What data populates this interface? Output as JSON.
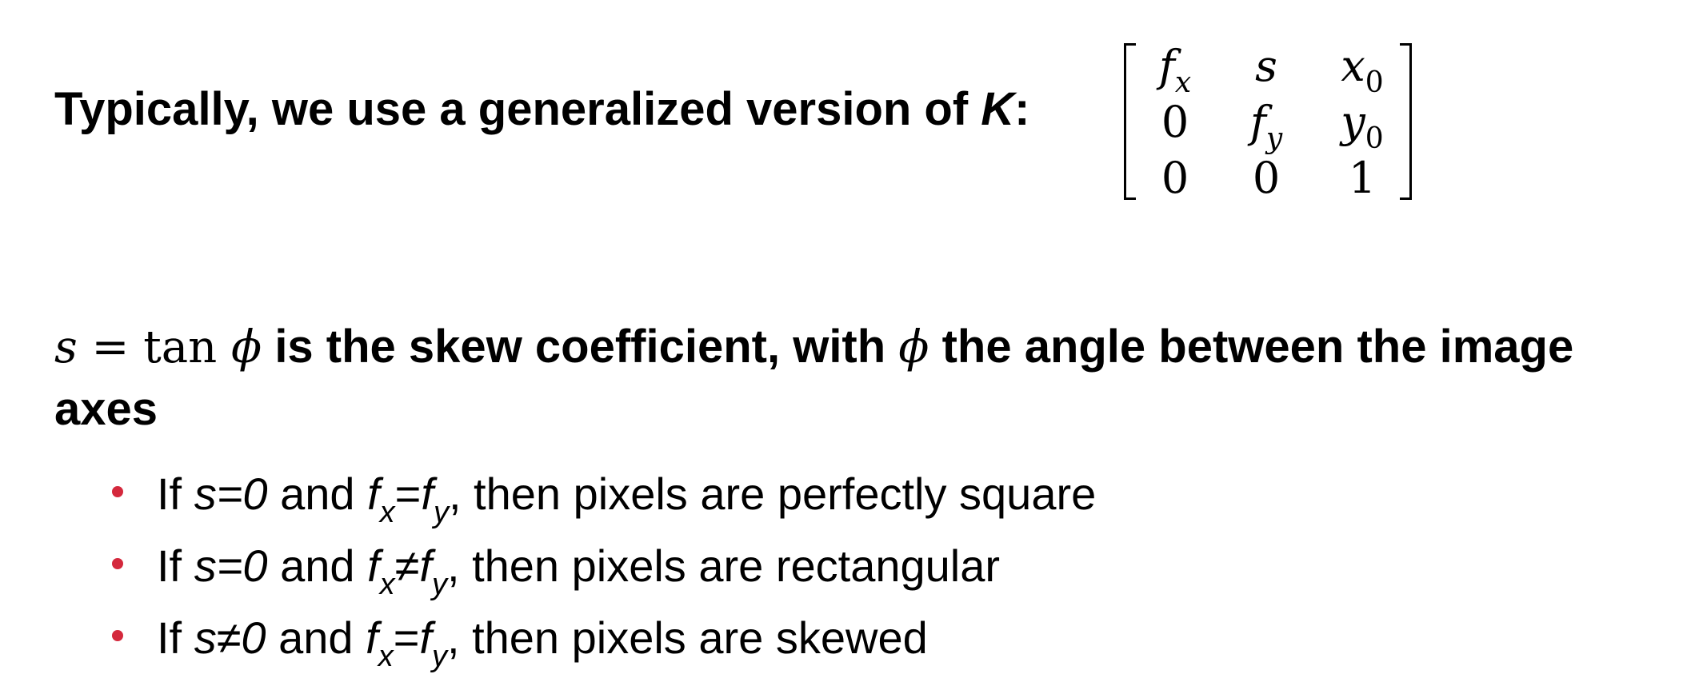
{
  "heading": {
    "prefix": "Typically, we use a generalized version of ",
    "symbol": "K",
    "suffix": ":"
  },
  "matrix": {
    "rows": [
      [
        {
          "base": "f",
          "sub": "x"
        },
        {
          "base": "s",
          "sub": ""
        },
        {
          "base": "x",
          "sub": "0"
        }
      ],
      [
        {
          "base": "0",
          "sub": ""
        },
        {
          "base": "f",
          "sub": "y"
        },
        {
          "base": "y",
          "sub": "0"
        }
      ],
      [
        {
          "base": "0",
          "sub": ""
        },
        {
          "base": "0",
          "sub": ""
        },
        {
          "base": "1",
          "sub": ""
        }
      ]
    ]
  },
  "skew": {
    "math_s": "s",
    "math_eq": " = tan ",
    "math_phi": "ϕ",
    "text1": " is the skew coefficient, with ",
    "math_phi2": "ϕ",
    "text2": " the angle between the image",
    "text3": "axes"
  },
  "bullets": [
    {
      "if": "If ",
      "cond": "s=0",
      "and": " and ",
      "f1": "f",
      "s1": "x",
      "op": "=",
      "f2": "f",
      "s2": "y",
      "rest": ", then pixels are perfectly square"
    },
    {
      "if": "If ",
      "cond": "s=0",
      "and": " and ",
      "f1": "f",
      "s1": "x",
      "op": "≠",
      "f2": "f",
      "s2": "y",
      "rest": ", then pixels are rectangular"
    },
    {
      "if": "If ",
      "cond": "s≠0",
      "and": " and ",
      "f1": "f",
      "s1": "x",
      "op": "=",
      "f2": "f",
      "s2": "y",
      "rest": ", then pixels are skewed"
    }
  ],
  "colors": {
    "bullet": "#d4283c",
    "text": "#000000"
  }
}
